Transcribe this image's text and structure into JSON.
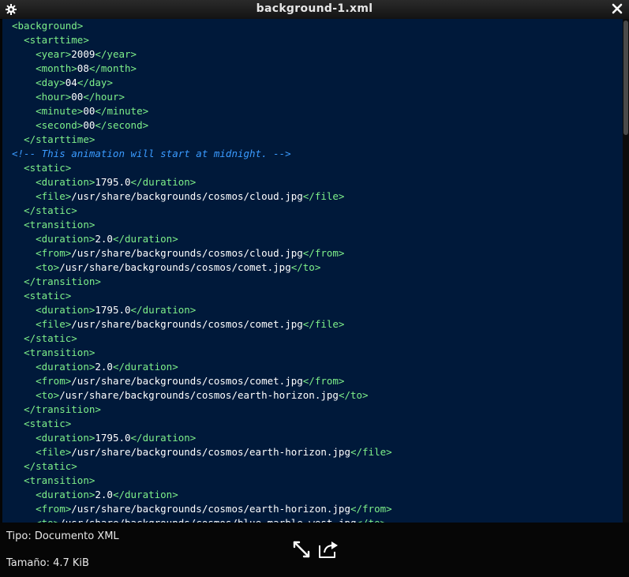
{
  "window": {
    "title": "background-1.xml"
  },
  "code_lines": [
    [
      {
        "c": "tag",
        "t": "<background>"
      }
    ],
    [
      {
        "c": "txt",
        "t": "  "
      },
      {
        "c": "tag",
        "t": "<starttime>"
      }
    ],
    [
      {
        "c": "txt",
        "t": "    "
      },
      {
        "c": "tag",
        "t": "<year>"
      },
      {
        "c": "txt",
        "t": "2009"
      },
      {
        "c": "tag",
        "t": "</year>"
      }
    ],
    [
      {
        "c": "txt",
        "t": "    "
      },
      {
        "c": "tag",
        "t": "<month>"
      },
      {
        "c": "txt",
        "t": "08"
      },
      {
        "c": "tag",
        "t": "</month>"
      }
    ],
    [
      {
        "c": "txt",
        "t": "    "
      },
      {
        "c": "tag",
        "t": "<day>"
      },
      {
        "c": "txt",
        "t": "04"
      },
      {
        "c": "tag",
        "t": "</day>"
      }
    ],
    [
      {
        "c": "txt",
        "t": "    "
      },
      {
        "c": "tag",
        "t": "<hour>"
      },
      {
        "c": "txt",
        "t": "00"
      },
      {
        "c": "tag",
        "t": "</hour>"
      }
    ],
    [
      {
        "c": "txt",
        "t": "    "
      },
      {
        "c": "tag",
        "t": "<minute>"
      },
      {
        "c": "txt",
        "t": "00"
      },
      {
        "c": "tag",
        "t": "</minute>"
      }
    ],
    [
      {
        "c": "txt",
        "t": "    "
      },
      {
        "c": "tag",
        "t": "<second>"
      },
      {
        "c": "txt",
        "t": "00"
      },
      {
        "c": "tag",
        "t": "</second>"
      }
    ],
    [
      {
        "c": "txt",
        "t": "  "
      },
      {
        "c": "tag",
        "t": "</starttime>"
      }
    ],
    [
      {
        "c": "cmt",
        "t": "<!-- This animation will start at midnight. -->"
      }
    ],
    [
      {
        "c": "txt",
        "t": "  "
      },
      {
        "c": "tag",
        "t": "<static>"
      }
    ],
    [
      {
        "c": "txt",
        "t": "    "
      },
      {
        "c": "tag",
        "t": "<duration>"
      },
      {
        "c": "txt",
        "t": "1795.0"
      },
      {
        "c": "tag",
        "t": "</duration>"
      }
    ],
    [
      {
        "c": "txt",
        "t": "    "
      },
      {
        "c": "tag",
        "t": "<file>"
      },
      {
        "c": "txt",
        "t": "/usr/share/backgrounds/cosmos/cloud.jpg"
      },
      {
        "c": "tag",
        "t": "</file>"
      }
    ],
    [
      {
        "c": "txt",
        "t": "  "
      },
      {
        "c": "tag",
        "t": "</static>"
      }
    ],
    [
      {
        "c": "txt",
        "t": "  "
      },
      {
        "c": "tag",
        "t": "<transition>"
      }
    ],
    [
      {
        "c": "txt",
        "t": "    "
      },
      {
        "c": "tag",
        "t": "<duration>"
      },
      {
        "c": "txt",
        "t": "2.0"
      },
      {
        "c": "tag",
        "t": "</duration>"
      }
    ],
    [
      {
        "c": "txt",
        "t": "    "
      },
      {
        "c": "tag",
        "t": "<from>"
      },
      {
        "c": "txt",
        "t": "/usr/share/backgrounds/cosmos/cloud.jpg"
      },
      {
        "c": "tag",
        "t": "</from>"
      }
    ],
    [
      {
        "c": "txt",
        "t": "    "
      },
      {
        "c": "tag",
        "t": "<to>"
      },
      {
        "c": "txt",
        "t": "/usr/share/backgrounds/cosmos/comet.jpg"
      },
      {
        "c": "tag",
        "t": "</to>"
      }
    ],
    [
      {
        "c": "txt",
        "t": "  "
      },
      {
        "c": "tag",
        "t": "</transition>"
      }
    ],
    [
      {
        "c": "txt",
        "t": "  "
      },
      {
        "c": "tag",
        "t": "<static>"
      }
    ],
    [
      {
        "c": "txt",
        "t": "    "
      },
      {
        "c": "tag",
        "t": "<duration>"
      },
      {
        "c": "txt",
        "t": "1795.0"
      },
      {
        "c": "tag",
        "t": "</duration>"
      }
    ],
    [
      {
        "c": "txt",
        "t": "    "
      },
      {
        "c": "tag",
        "t": "<file>"
      },
      {
        "c": "txt",
        "t": "/usr/share/backgrounds/cosmos/comet.jpg"
      },
      {
        "c": "tag",
        "t": "</file>"
      }
    ],
    [
      {
        "c": "txt",
        "t": "  "
      },
      {
        "c": "tag",
        "t": "</static>"
      }
    ],
    [
      {
        "c": "txt",
        "t": "  "
      },
      {
        "c": "tag",
        "t": "<transition>"
      }
    ],
    [
      {
        "c": "txt",
        "t": "    "
      },
      {
        "c": "tag",
        "t": "<duration>"
      },
      {
        "c": "txt",
        "t": "2.0"
      },
      {
        "c": "tag",
        "t": "</duration>"
      }
    ],
    [
      {
        "c": "txt",
        "t": "    "
      },
      {
        "c": "tag",
        "t": "<from>"
      },
      {
        "c": "txt",
        "t": "/usr/share/backgrounds/cosmos/comet.jpg"
      },
      {
        "c": "tag",
        "t": "</from>"
      }
    ],
    [
      {
        "c": "txt",
        "t": "    "
      },
      {
        "c": "tag",
        "t": "<to>"
      },
      {
        "c": "txt",
        "t": "/usr/share/backgrounds/cosmos/earth-horizon.jpg"
      },
      {
        "c": "tag",
        "t": "</to>"
      }
    ],
    [
      {
        "c": "txt",
        "t": "  "
      },
      {
        "c": "tag",
        "t": "</transition>"
      }
    ],
    [
      {
        "c": "txt",
        "t": "  "
      },
      {
        "c": "tag",
        "t": "<static>"
      }
    ],
    [
      {
        "c": "txt",
        "t": "    "
      },
      {
        "c": "tag",
        "t": "<duration>"
      },
      {
        "c": "txt",
        "t": "1795.0"
      },
      {
        "c": "tag",
        "t": "</duration>"
      }
    ],
    [
      {
        "c": "txt",
        "t": "    "
      },
      {
        "c": "tag",
        "t": "<file>"
      },
      {
        "c": "txt",
        "t": "/usr/share/backgrounds/cosmos/earth-horizon.jpg"
      },
      {
        "c": "tag",
        "t": "</file>"
      }
    ],
    [
      {
        "c": "txt",
        "t": "  "
      },
      {
        "c": "tag",
        "t": "</static>"
      }
    ],
    [
      {
        "c": "txt",
        "t": "  "
      },
      {
        "c": "tag",
        "t": "<transition>"
      }
    ],
    [
      {
        "c": "txt",
        "t": "    "
      },
      {
        "c": "tag",
        "t": "<duration>"
      },
      {
        "c": "txt",
        "t": "2.0"
      },
      {
        "c": "tag",
        "t": "</duration>"
      }
    ],
    [
      {
        "c": "txt",
        "t": "    "
      },
      {
        "c": "tag",
        "t": "<from>"
      },
      {
        "c": "txt",
        "t": "/usr/share/backgrounds/cosmos/earth-horizon.jpg"
      },
      {
        "c": "tag",
        "t": "</from>"
      }
    ],
    [
      {
        "c": "txt",
        "t": "    "
      },
      {
        "c": "tag",
        "t": "<to>"
      },
      {
        "c": "txt",
        "t": "/usr/share/backgrounds/cosmos/blue-marble-west.jpg"
      },
      {
        "c": "tag",
        "t": "</to>"
      }
    ]
  ],
  "footer": {
    "type_label": "Tipo: Documento XML",
    "size_label": "Tamaño: 4.7 KiB"
  },
  "icons": {
    "settings": "gear-icon",
    "close": "close-icon",
    "fullscreen": "expand-arrows-icon",
    "open_with": "share-arrow-icon"
  },
  "colors": {
    "editor_background": "#00193a",
    "tag": "#7ef08a",
    "text": "#ffffff",
    "comment": "#3a9bff"
  }
}
